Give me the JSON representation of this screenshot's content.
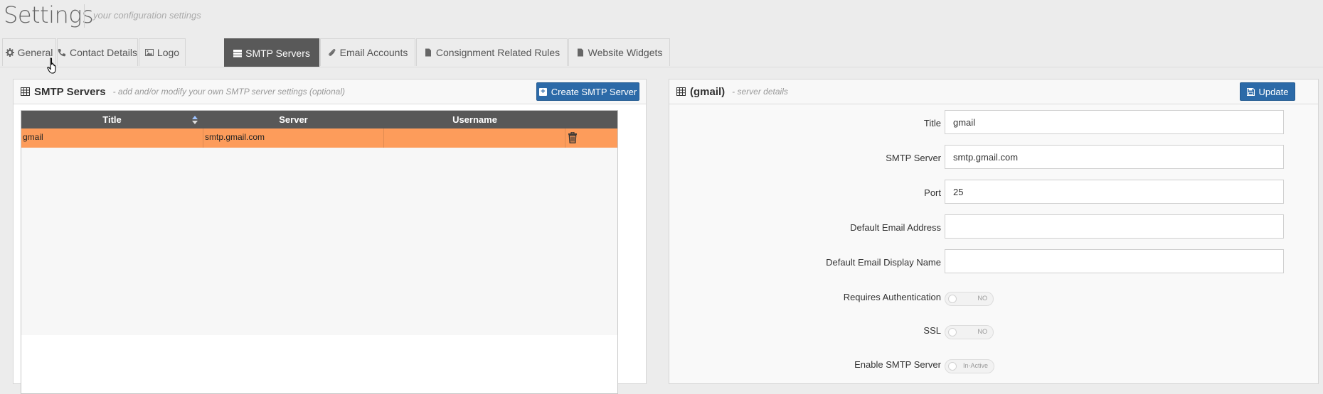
{
  "header": {
    "title": "Settings",
    "subtitle": "your configuration settings"
  },
  "tabs": [
    {
      "label": "General",
      "icon": "gear-icon",
      "active": false
    },
    {
      "label": "Contact Details",
      "icon": "phone-icon",
      "active": false
    },
    {
      "label": "Logo",
      "icon": "image-icon",
      "active": false
    },
    {
      "label": "SMTP Servers",
      "icon": "server-icon",
      "active": true
    },
    {
      "label": "Email Accounts",
      "icon": "paperclip-icon",
      "active": false
    },
    {
      "label": "Consignment Related Rules",
      "icon": "file-icon",
      "active": false
    },
    {
      "label": "Website Widgets",
      "icon": "file-icon",
      "active": false
    }
  ],
  "left_panel": {
    "title": "SMTP Servers",
    "description": "- add and/or modify your own SMTP server settings (optional)",
    "create_button": "Create SMTP Server",
    "table": {
      "columns": [
        "Title",
        "Server",
        "Username"
      ],
      "rows": [
        {
          "title": "gmail",
          "server": "smtp.gmail.com",
          "username": ""
        }
      ]
    }
  },
  "right_panel": {
    "title": "(gmail)",
    "description": "- server details",
    "update_button": "Update",
    "fields": {
      "title": {
        "label": "Title",
        "value": "gmail"
      },
      "smtp_server": {
        "label": "SMTP Server",
        "value": "smtp.gmail.com"
      },
      "port": {
        "label": "Port",
        "value": "25"
      },
      "default_email": {
        "label": "Default Email Address",
        "value": ""
      },
      "default_display_name": {
        "label": "Default Email Display Name",
        "value": ""
      },
      "requires_auth": {
        "label": "Requires Authentication",
        "state": "NO"
      },
      "ssl": {
        "label": "SSL",
        "state": "NO"
      },
      "enable": {
        "label": "Enable SMTP Server",
        "state": "In-Active"
      }
    }
  },
  "colors": {
    "active_tab": "#595959",
    "primary_button": "#2c6aa8",
    "selected_row": "#fd9c5b",
    "grid_header": "#585858"
  }
}
